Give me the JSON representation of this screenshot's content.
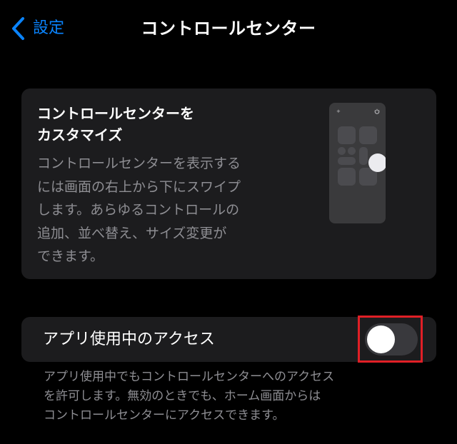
{
  "nav": {
    "back_label": "設定",
    "title": "コントロールセンター"
  },
  "info_card": {
    "title_line1": "コントロールセンターを",
    "title_line2": "カスタマイズ",
    "desc_lines": [
      "コントロールセンターを表示する",
      "には画面の右上から下にスワイプ",
      "します。あらゆるコントロールの",
      "追加、並べ替え、サイズ変更が",
      "できます。"
    ],
    "illustration": {
      "top_left_icon": "plus-icon",
      "top_right_icon": "power-icon"
    }
  },
  "access_setting": {
    "label": "アプリ使用中のアクセス",
    "enabled": false
  },
  "footer": {
    "lines": [
      "アプリ使用中でもコントロールセンターへのアクセス",
      "を許可します。無効のときでも、ホーム画面からは",
      "コントロールセンターにアクセスできます。"
    ]
  },
  "colors": {
    "background": "#000000",
    "card": "#1c1c1e",
    "accent_blue": "#0a84ff",
    "secondary_text": "#8e8e93",
    "toggle_off": "#39393d",
    "highlight_red": "#e01f26"
  }
}
